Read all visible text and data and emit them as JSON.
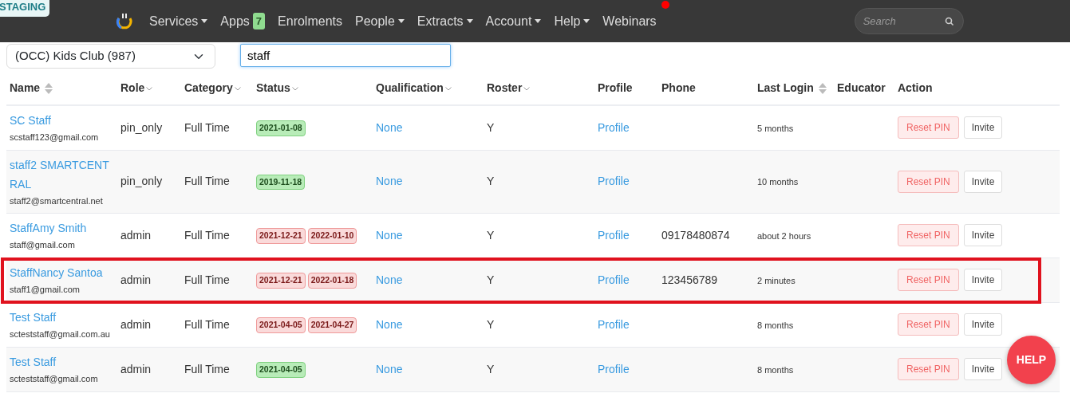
{
  "environment_badge": "STAGING",
  "navbar": {
    "items": [
      {
        "label": "Services",
        "dropdown": true
      },
      {
        "label": "Apps",
        "badge": "7",
        "dropdown": false
      },
      {
        "label": "Enrolments",
        "dropdown": false
      },
      {
        "label": "People",
        "dropdown": true
      },
      {
        "label": "Extracts",
        "dropdown": true
      },
      {
        "label": "Account",
        "dropdown": true
      },
      {
        "label": "Help",
        "dropdown": true
      },
      {
        "label": "Webinars",
        "dropdown": false,
        "notification": true
      }
    ],
    "search": {
      "placeholder": "Search"
    }
  },
  "filters": {
    "service": {
      "value": "(OCC) Kids Club (987)"
    },
    "filter": {
      "value": "staff"
    }
  },
  "table": {
    "columns": [
      {
        "label": "Name",
        "kind": "sortable"
      },
      {
        "label": "Role",
        "kind": "caret"
      },
      {
        "label": "Category",
        "kind": "caret"
      },
      {
        "label": "Status",
        "kind": "caret"
      },
      {
        "label": "Qualification",
        "kind": "caret"
      },
      {
        "label": "Roster",
        "kind": "caret"
      },
      {
        "label": "Profile",
        "kind": "plain"
      },
      {
        "label": "Phone",
        "kind": "plain"
      },
      {
        "label": "Last Login",
        "kind": "sortable"
      },
      {
        "label": "Educator",
        "kind": "plain"
      },
      {
        "label": "Action",
        "kind": "plain"
      }
    ],
    "rows": [
      {
        "name": "SC Staff",
        "email": "scstaff123@gmail.com",
        "role": "pin_only",
        "category": "Full Time",
        "status": [
          {
            "date": "2021-01-08",
            "kind": "success"
          }
        ],
        "qualification": "None",
        "roster": "Y",
        "profile": "Profile",
        "last_login": "5 months",
        "actions": [
          "Reset PIN",
          "Invite"
        ],
        "highlighted": false
      },
      {
        "name": "staff2 SMARTCENTRAL",
        "email": "staff2@smartcentral.net",
        "role": "pin_only",
        "category": "Full Time",
        "status": [
          {
            "date": "2019-11-18",
            "kind": "success"
          }
        ],
        "qualification": "None",
        "roster": "Y",
        "profile": "Profile",
        "last_login": "10 months",
        "actions": [
          "Reset PIN",
          "Invite"
        ],
        "highlighted": false
      },
      {
        "name": "StaffAmy Smith",
        "email": "staff@gmail.com",
        "role": "admin",
        "category": "Full Time",
        "status": [
          {
            "date": "2021-12-21",
            "kind": "danger"
          },
          {
            "date": "2022-01-10",
            "kind": "danger"
          }
        ],
        "qualification": "None",
        "roster": "Y",
        "profile": "Profile",
        "phone": "09178480874",
        "last_login": "about 2 hours",
        "actions": [
          "Reset PIN",
          "Invite"
        ],
        "highlighted": false
      },
      {
        "name": "StaffNancy Santoa",
        "email": "staff1@gmail.com",
        "role": "admin",
        "category": "Full Time",
        "status": [
          {
            "date": "2021-12-21",
            "kind": "danger"
          },
          {
            "date": "2022-01-18",
            "kind": "danger"
          }
        ],
        "qualification": "None",
        "roster": "Y",
        "profile": "Profile",
        "phone": "123456789",
        "last_login": "2 minutes",
        "actions": [
          "Reset PIN",
          "Invite"
        ],
        "highlighted": true
      },
      {
        "name": "Test Staff",
        "email": "scteststaff@gmail.com.au",
        "role": "admin",
        "category": "Full Time",
        "status": [
          {
            "date": "2021-04-05",
            "kind": "danger"
          },
          {
            "date": "2021-04-27",
            "kind": "danger"
          }
        ],
        "qualification": "None",
        "roster": "Y",
        "profile": "Profile",
        "last_login": "8 months",
        "actions": [
          "Reset PIN",
          "Invite"
        ],
        "highlighted": false
      },
      {
        "name": "Test Staff",
        "email": "scteststaff@gmail.com",
        "role": "admin",
        "category": "Full Time",
        "status": [
          {
            "date": "2021-04-05",
            "kind": "success"
          }
        ],
        "qualification": "None",
        "roster": "Y",
        "profile": "Profile",
        "last_login": "8 months",
        "actions": [
          "Reset PIN",
          "Invite"
        ],
        "highlighted": false
      }
    ]
  },
  "help_button": "HELP"
}
